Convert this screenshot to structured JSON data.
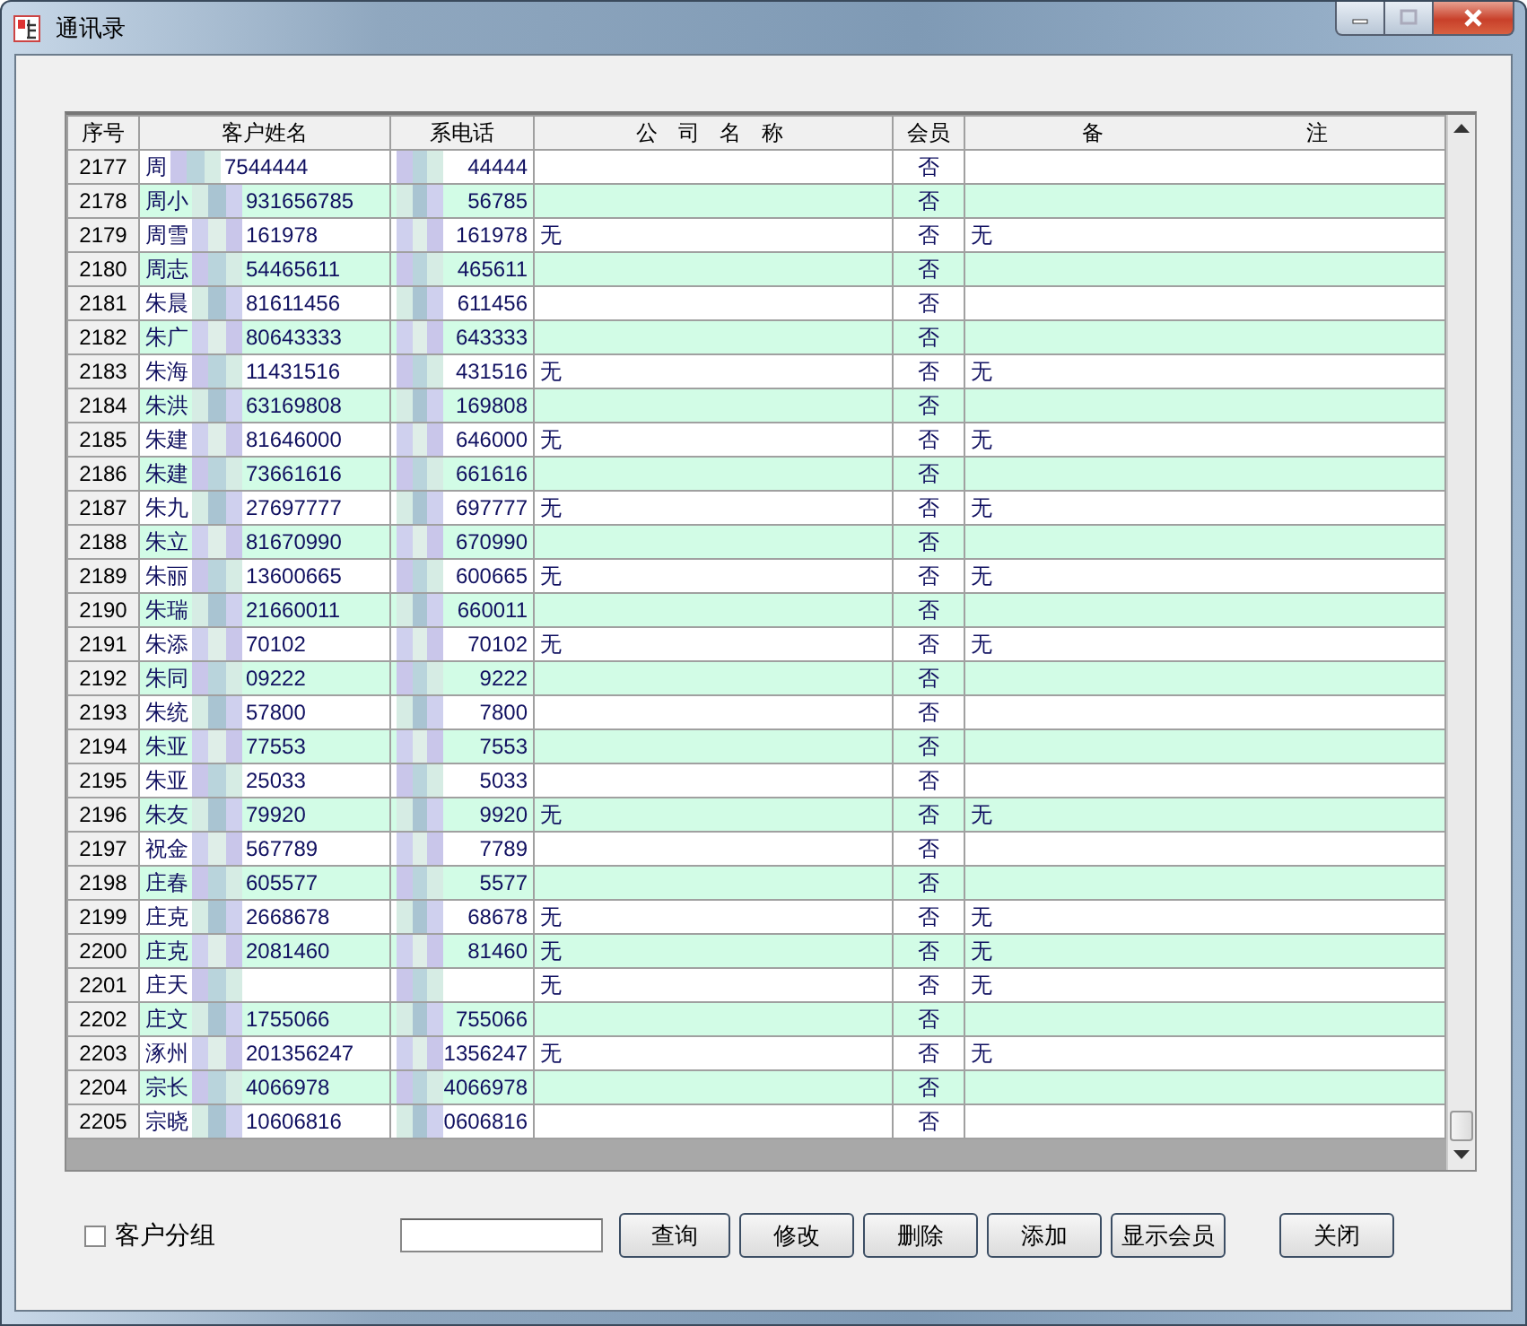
{
  "window": {
    "title": "通讯录"
  },
  "table": {
    "columns": [
      "序号",
      "客户姓名",
      "系电话",
      "公 司 名 称",
      "会员",
      "备 注"
    ],
    "rows": [
      {
        "no": "2177",
        "name_start": "周",
        "name_end": "7544444",
        "phone": "44444",
        "member": "否"
      },
      {
        "no": "2178",
        "name_start": "周小",
        "name_end": "931656785",
        "phone": "56785",
        "member": "否"
      },
      {
        "no": "2179",
        "name_start": "周雪",
        "name_end": "161978",
        "phone": "161978",
        "company": "无",
        "member": "否",
        "remark": "无"
      },
      {
        "no": "2180",
        "name_start": "周志",
        "name_end": "54465611",
        "phone": "465611",
        "member": "否"
      },
      {
        "no": "2181",
        "name_start": "朱晨",
        "name_end": "81611456",
        "phone": "611456",
        "member": "否"
      },
      {
        "no": "2182",
        "name_start": "朱广",
        "name_end": "80643333",
        "phone": "643333",
        "member": "否"
      },
      {
        "no": "2183",
        "name_start": "朱海",
        "name_end": "11431516",
        "phone": "431516",
        "company": "无",
        "member": "否",
        "remark": "无"
      },
      {
        "no": "2184",
        "name_start": "朱洪",
        "name_end": "63169808",
        "phone": "169808",
        "member": "否"
      },
      {
        "no": "2185",
        "name_start": "朱建",
        "name_end": "81646000",
        "phone": "646000",
        "company": "无",
        "member": "否",
        "remark": "无"
      },
      {
        "no": "2186",
        "name_start": "朱建",
        "name_end": "73661616",
        "phone": "661616",
        "member": "否"
      },
      {
        "no": "2187",
        "name_start": "朱九",
        "name_end": "27697777",
        "phone": "697777",
        "company": "无",
        "member": "否",
        "remark": "无"
      },
      {
        "no": "2188",
        "name_start": "朱立",
        "name_end": "81670990",
        "phone": "670990",
        "member": "否"
      },
      {
        "no": "2189",
        "name_start": "朱丽",
        "name_end": "13600665",
        "phone": "600665",
        "company": "无",
        "member": "否",
        "remark": "无"
      },
      {
        "no": "2190",
        "name_start": "朱瑞",
        "name_end": "21660011",
        "phone": "660011",
        "member": "否"
      },
      {
        "no": "2191",
        "name_start": "朱添",
        "name_end": "70102",
        "phone": "70102",
        "company": "无",
        "member": "否",
        "remark": "无"
      },
      {
        "no": "2192",
        "name_start": "朱同",
        "name_end": "09222",
        "phone": "9222",
        "member": "否"
      },
      {
        "no": "2193",
        "name_start": "朱统",
        "name_end": "57800",
        "phone": "7800",
        "member": "否"
      },
      {
        "no": "2194",
        "name_start": "朱亚",
        "name_end": "77553",
        "phone": "7553",
        "member": "否"
      },
      {
        "no": "2195",
        "name_start": "朱亚",
        "name_end": "25033",
        "phone": "5033",
        "member": "否"
      },
      {
        "no": "2196",
        "name_start": "朱友",
        "name_end": "79920",
        "phone": "9920",
        "company": "无",
        "member": "否",
        "remark": "无"
      },
      {
        "no": "2197",
        "name_start": "祝金",
        "name_end": "567789",
        "phone": "7789",
        "member": "否"
      },
      {
        "no": "2198",
        "name_start": "庄春",
        "name_end": "605577",
        "phone": "5577",
        "member": "否"
      },
      {
        "no": "2199",
        "name_start": "庄克",
        "name_end": "2668678",
        "phone": "68678",
        "company": "无",
        "member": "否",
        "remark": "无"
      },
      {
        "no": "2200",
        "name_start": "庄克",
        "name_end": "2081460",
        "phone": "81460",
        "company": "无",
        "member": "否",
        "remark": "无"
      },
      {
        "no": "2201",
        "name_start": "庄天",
        "company": "无",
        "member": "否",
        "remark": "无"
      },
      {
        "no": "2202",
        "name_start": "庄文",
        "name_end": "1755066",
        "phone": "755066",
        "member": "否"
      },
      {
        "no": "2203",
        "name_start": "涿州",
        "name_end": "201356247",
        "phone": "1356247",
        "company": "无",
        "member": "否",
        "remark": "无"
      },
      {
        "no": "2204",
        "name_start": "宗长",
        "name_end": "4066978",
        "phone": "4066978",
        "member": "否"
      },
      {
        "no": "2205",
        "name_start": "宗晓",
        "name_end": "10606816",
        "phone": "0606816",
        "member": "否"
      }
    ]
  },
  "group_checkbox": {
    "label": "客户分组",
    "checked": false
  },
  "buttons": [
    "查询",
    "修改",
    "删除",
    "添加",
    "显示会员"
  ],
  "close_button": "关闭"
}
